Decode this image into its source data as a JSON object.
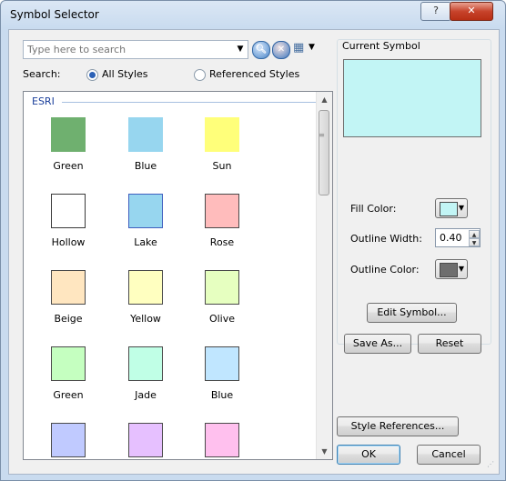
{
  "window": {
    "title": "Symbol Selector",
    "help_glyph": "?",
    "close_glyph": "✕"
  },
  "search": {
    "placeholder": "Type here to search",
    "value": "",
    "label": "Search:",
    "options": [
      "All Styles",
      "Referenced Styles"
    ],
    "selected": "All Styles"
  },
  "gallery": {
    "group": "ESRI",
    "symbols": [
      {
        "name": "Green",
        "color": "#6fb06f",
        "border": "#6fb06f"
      },
      {
        "name": "Blue",
        "color": "#97d6ef",
        "border": "#97d6ef"
      },
      {
        "name": "Sun",
        "color": "#ffff7a",
        "border": "#ffff7a"
      },
      {
        "name": "Hollow",
        "color": "#ffffff",
        "border": "#3a3a3a"
      },
      {
        "name": "Lake",
        "color": "#97d6ef",
        "border": "#3f5fbf"
      },
      {
        "name": "Rose",
        "color": "#ffbcbc",
        "border": "#4a4a4a"
      },
      {
        "name": "Beige",
        "color": "#ffe6c0",
        "border": "#4a4a4a"
      },
      {
        "name": "Yellow",
        "color": "#ffffc0",
        "border": "#4a4a4a"
      },
      {
        "name": "Olive",
        "color": "#e6ffc0",
        "border": "#4a4a4a"
      },
      {
        "name": "Green",
        "color": "#c5ffc0",
        "border": "#4a4a4a"
      },
      {
        "name": "Jade",
        "color": "#c0ffe6",
        "border": "#4a4a4a"
      },
      {
        "name": "Blue",
        "color": "#c0e6ff",
        "border": "#4a4a4a"
      },
      {
        "name": "",
        "color": "#c0caff",
        "border": "#4a4a4a"
      },
      {
        "name": "",
        "color": "#e6c0ff",
        "border": "#4a4a4a"
      },
      {
        "name": "",
        "color": "#ffc0ee",
        "border": "#4a4a4a"
      }
    ]
  },
  "current_symbol": {
    "title": "Current Symbol",
    "preview_color": "#c2f5f5",
    "fill_color_label": "Fill Color:",
    "fill_color": "#c2f5f5",
    "outline_width_label": "Outline Width:",
    "outline_width": "0.40",
    "outline_color_label": "Outline Color:",
    "outline_color": "#6e6e6e"
  },
  "buttons": {
    "edit_symbol": "Edit Symbol...",
    "save_as": "Save As...",
    "reset": "Reset",
    "style_references": "Style References...",
    "ok": "OK",
    "cancel": "Cancel"
  }
}
